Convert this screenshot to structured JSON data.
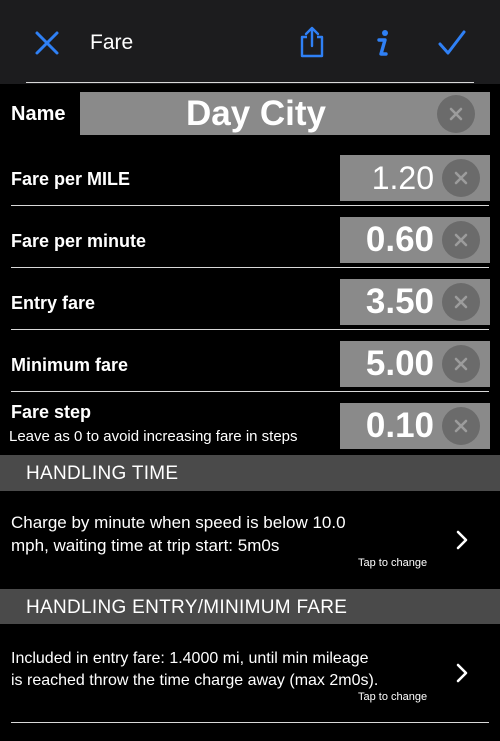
{
  "nav": {
    "title": "Fare",
    "icons": {
      "close": "close-icon",
      "share": "share-icon",
      "info": "info-icon",
      "done": "checkmark-icon"
    },
    "accent_color": "#2f80f5"
  },
  "fields": {
    "name": {
      "label": "Name",
      "value": "Day City"
    },
    "fare_per_mile": {
      "label": "Fare per MILE",
      "value": "1.20"
    },
    "fare_per_minute": {
      "label": "Fare per minute",
      "value": "0.60"
    },
    "entry_fare": {
      "label": "Entry fare",
      "value": "3.50"
    },
    "minimum_fare": {
      "label": "Minimum fare",
      "value": "5.00"
    },
    "fare_step": {
      "label": "Fare step",
      "hint": "Leave as 0 to avoid increasing fare in steps",
      "value": "0.10"
    }
  },
  "handling_time": {
    "header": "HANDLING TIME",
    "line1": "Charge by minute when speed is below 10.0",
    "line2": "mph, waiting time at trip start: 5m0s",
    "tap_label": "Tap to change"
  },
  "handling_entry": {
    "header": "HANDLING ENTRY/MINIMUM FARE",
    "line1": "Included in entry fare: 1.4000 mi, until min mileage",
    "line2": "is reached throw the time charge away (max 2m0s).",
    "tap_label": "Tap to change"
  },
  "colors": {
    "background": "#000000",
    "navbar": "#1c1c1e",
    "field": "#8a8a8a",
    "clear_button": "#6b6b6b",
    "section_header": "#4a4a4a"
  }
}
